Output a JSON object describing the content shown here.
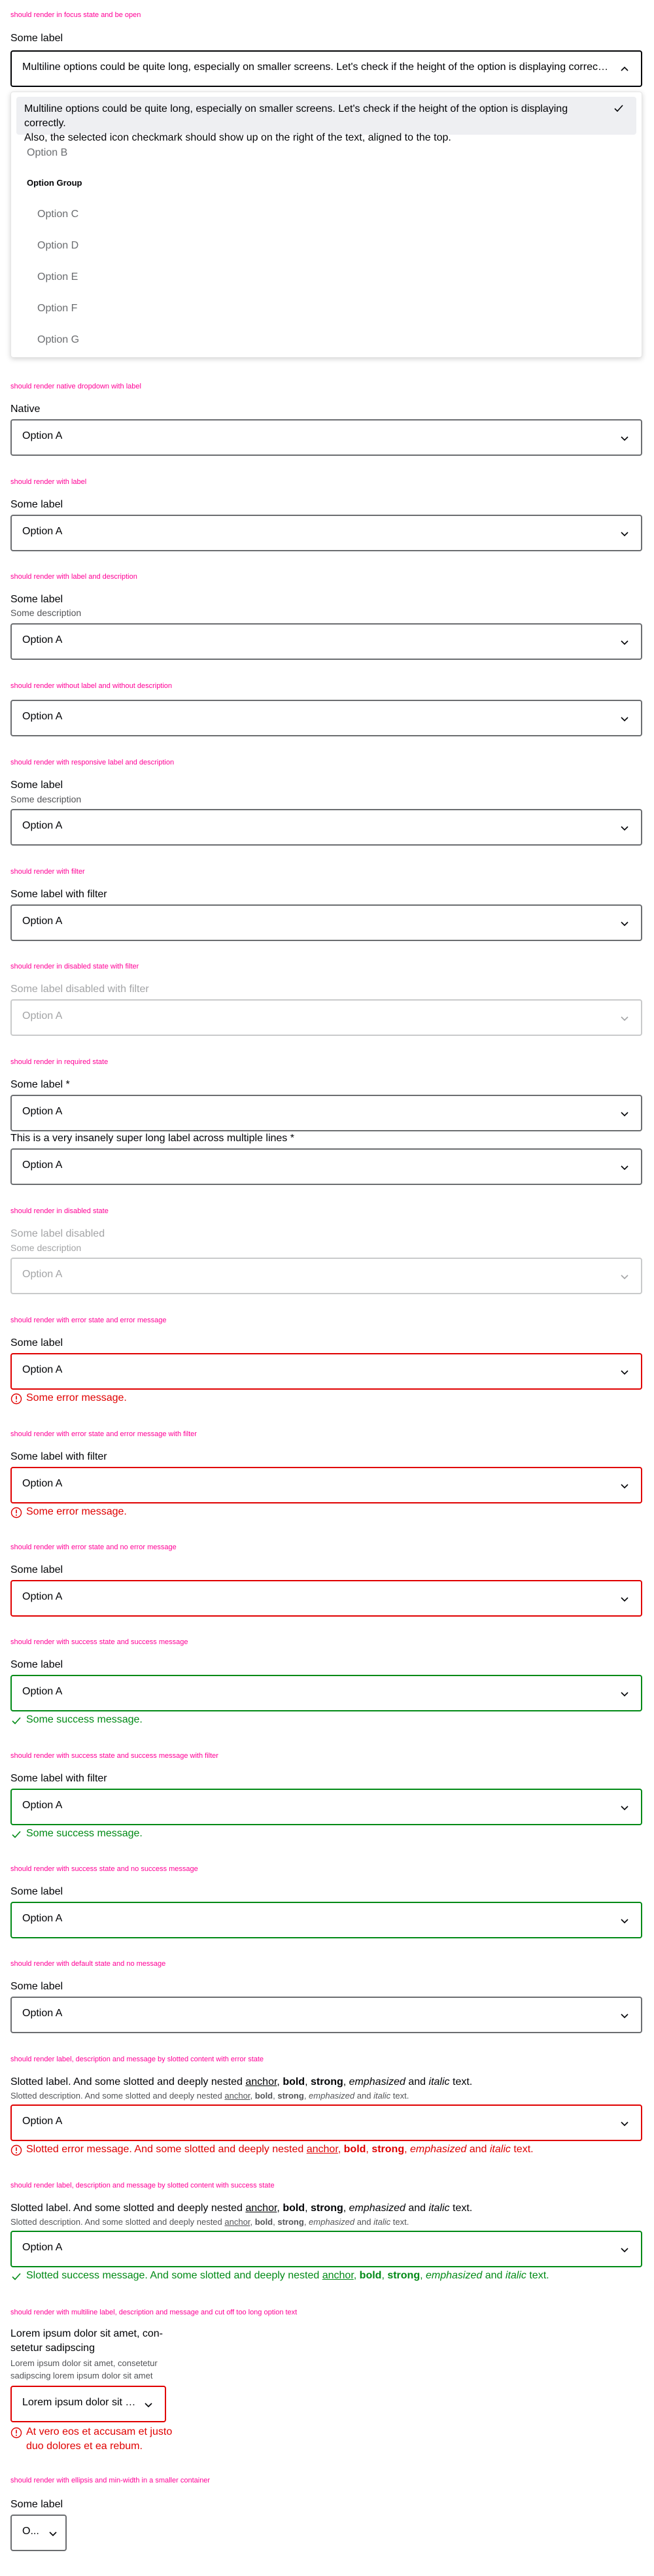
{
  "cases": {
    "focus_open": "should render in focus state and be open",
    "native": "should render native dropdown with label",
    "with_label": "should render with label",
    "label_desc": "should render with label and description",
    "no_label": "should render without label and without description",
    "responsive": "should render with responsive label and description",
    "filter": "should render with filter",
    "disabled_filter": "should render in disabled state with filter",
    "required": "should render in required state",
    "disabled": "should render in disabled state",
    "error_msg": "should render with error state and error message",
    "error_msg_filter": "should render with error state and error message with filter",
    "error_no_msg": "should render with error state and no error message",
    "success_msg": "should render with success state and success message",
    "success_msg_filter": "should render with success state and success message with filter",
    "success_no_msg": "should render with success state and no success message",
    "default_no_msg": "should render with default state and no message",
    "slotted_error": "should render label, description and message by slotted content with error state",
    "slotted_success": "should render label, description and message by slotted content with success state",
    "multiline": "should render with multiline label, description and message and cut off too long option text",
    "ellipsis": "should render with ellipsis and min-width in a smaller container"
  },
  "labels": {
    "some_label": "Some label",
    "native": "Native",
    "some_desc": "Some description",
    "with_filter": "Some label with filter",
    "disabled_filter": "Some label disabled with filter",
    "required": "Some label *",
    "long_required": "This is a very insanely super long label across multiple lines *",
    "disabled": "Some label disabled",
    "option_a": "Option A",
    "error": "Some error message.",
    "success": "Some success message."
  },
  "open_select": {
    "value": "Multiline options could be quite long, especially on smaller screens. Let's check if the height of the option is displaying correctly. Als...",
    "options": [
      {
        "text": "Multiline options could be quite long, especially on smaller screens. Let's check if the height of the option is displaying correctly.",
        "text2": "Also, the selected icon checkmark should show up on the right of the text, aligned to the top."
      },
      {
        "text": "Option B"
      },
      {
        "text": "Option Group"
      },
      {
        "text": "Option C"
      },
      {
        "text": "Option D"
      },
      {
        "text": "Option E"
      },
      {
        "text": "Option F"
      },
      {
        "text": "Option G"
      }
    ]
  },
  "slotted": {
    "label_pre": "Slotted label. And some slotted and deeply nested",
    "desc_pre": "Slotted description. And some slotted and deeply nested",
    "error_pre": "Slotted error message. And some slotted and deeply nested",
    "success_pre": "Slotted success message. And some slotted and deeply nested",
    "anchor": "anchor",
    "bold": "bold",
    "strong": "strong",
    "emph": "emphasized",
    "and": "and",
    "italic": "italic",
    "text": "text."
  },
  "multiline": {
    "label1": "Lorem ipsum dolor sit amet, con-",
    "label2": "setetur sadipscing",
    "desc1": "Lorem ipsum dolor sit amet, consetetur",
    "desc2": "sadipscing lorem ipsum dolor sit amet",
    "value": "Lorem ipsum dolor sit a...",
    "msg1": "At vero eos et accusam et justo",
    "msg2": "duo dolores et ea rebum."
  },
  "ellipsis_value": "O...",
  "colors": {
    "accent": "#ff0096",
    "error": "#e00000",
    "success": "#018a16",
    "border": "#6b6d70"
  }
}
